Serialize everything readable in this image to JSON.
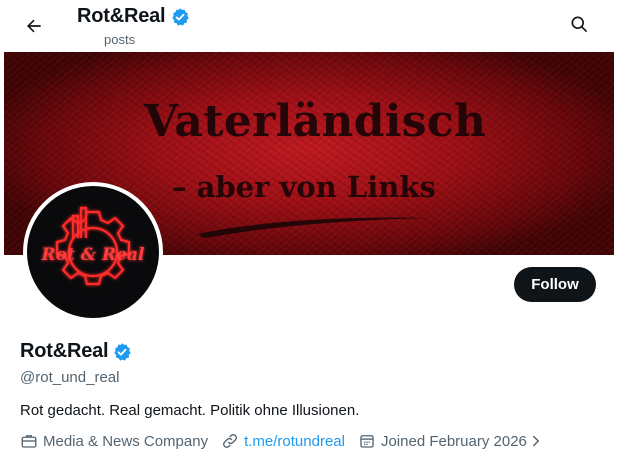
{
  "header": {
    "title": "Rot&Real",
    "subtitle": "posts",
    "back_icon": "arrow-left-icon",
    "search_icon": "search-icon"
  },
  "banner": {
    "line1": "Vaterländisch",
    "line2": "– aber von Links"
  },
  "avatar": {
    "logo_text": "Rot & Real"
  },
  "profile": {
    "name": "Rot&Real",
    "verified": true,
    "handle": "@rot_und_real",
    "bio": "Rot gedacht. Real gemacht. Politik ohne Illusionen.",
    "category": "Media & News Company",
    "link": "t.me/rotundreal",
    "joined": "Joined February 2026"
  },
  "actions": {
    "follow_label": "Follow"
  },
  "colors": {
    "accent": "#1d9bf0",
    "text_primary": "#0f1419",
    "text_secondary": "#536471",
    "banner_red": "#a3121a",
    "button_dark": "#0f1419"
  }
}
